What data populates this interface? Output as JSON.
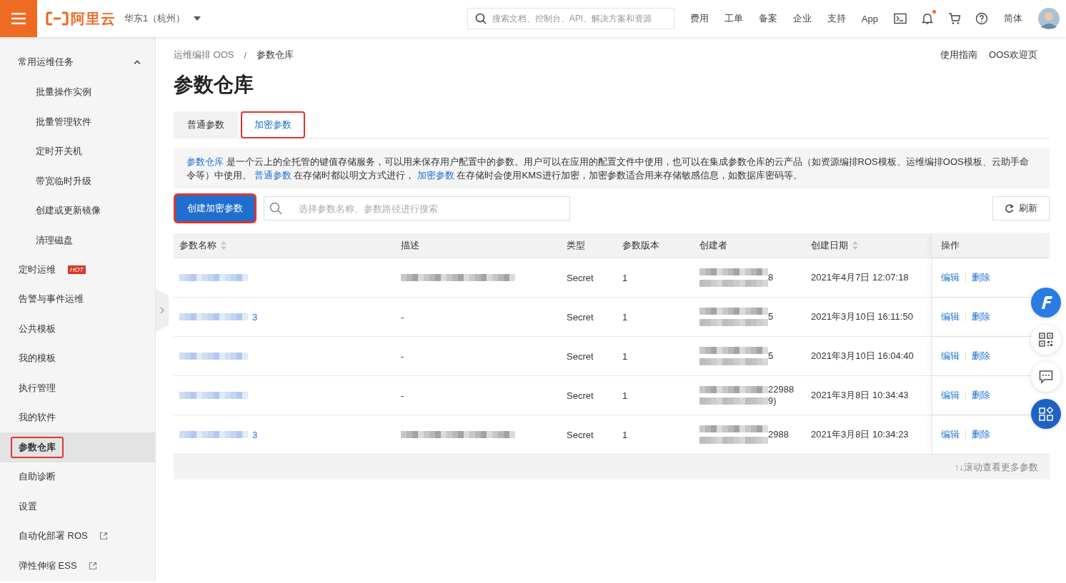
{
  "topbar": {
    "brand": "阿里云",
    "region": "华东1（杭州）",
    "search": {
      "placeholder": "搜索文档、控制台、API、解决方案和资源"
    },
    "links": [
      "费用",
      "工单",
      "备案",
      "企业",
      "支持",
      "App"
    ],
    "notification_dot": true,
    "language": "简体"
  },
  "sidebar": {
    "groups": [
      {
        "label": "常用运维任务",
        "expanded": true,
        "children": [
          {
            "label": "批量操作实例",
            "selected": false
          },
          {
            "label": "批量管理软件",
            "selected": false
          },
          {
            "label": "定时开关机",
            "selected": false
          },
          {
            "label": "带宽临时升级",
            "selected": false
          },
          {
            "label": "创建或更新镜像",
            "selected": false
          },
          {
            "label": "清理磁盘",
            "selected": false
          }
        ]
      }
    ],
    "items": [
      {
        "label": "定时运维",
        "badge": "HOT",
        "selected": false,
        "highlighted": false
      },
      {
        "label": "告警与事件运维",
        "selected": false,
        "highlighted": false
      },
      {
        "label": "公共模板",
        "selected": false,
        "highlighted": false
      },
      {
        "label": "我的模板",
        "selected": false,
        "highlighted": false
      },
      {
        "label": "执行管理",
        "selected": false,
        "highlighted": false
      },
      {
        "label": "我的软件",
        "selected": false,
        "highlighted": false
      },
      {
        "label": "参数仓库",
        "selected": true,
        "highlighted": true
      },
      {
        "label": "自助诊断",
        "selected": false,
        "highlighted": false
      },
      {
        "label": "设置",
        "selected": false,
        "highlighted": false
      },
      {
        "label": "自动化部署 ROS",
        "external": true,
        "selected": false,
        "highlighted": false
      },
      {
        "label": "弹性伸缩 ESS",
        "external": true,
        "selected": false,
        "highlighted": false
      }
    ]
  },
  "breadcrumb": {
    "items": [
      "运维编排 OOS",
      "参数仓库"
    ],
    "separator": "/"
  },
  "header_links": [
    "使用指南",
    "OOS欢迎页"
  ],
  "page_title": "参数仓库",
  "tabs": [
    {
      "label": "普通参数",
      "selected": false,
      "highlighted": false
    },
    {
      "label": "加密参数",
      "selected": true,
      "highlighted": true
    }
  ],
  "notice": [
    {
      "kind": "link",
      "text": "参数仓库"
    },
    {
      "kind": "text",
      "text": "是一个云上的全托管的键值存储服务，可以用来保存用户配置中的参数。用户可以在应用的配置文件中使用，也可以在集成参数仓库的云产品（如资源编排ROS模板、运维编排OOS模板、云助手命令等）中使用。"
    },
    {
      "kind": "link",
      "text": "普通参数"
    },
    {
      "kind": "text",
      "text": "在存储时都以明文方式进行，"
    },
    {
      "kind": "link",
      "text": "加密参数"
    },
    {
      "kind": "text",
      "text": "在存储时会使用KMS进行加密，加密参数适合用来存储敏感信息，如数据库密码等。"
    }
  ],
  "toolbar": {
    "create_button": {
      "label": "创建加密参数",
      "highlighted": true
    },
    "search": {
      "placeholder": "选择参数名称、参数路径进行搜索"
    },
    "refresh_button": "刷新"
  },
  "table": {
    "columns": [
      {
        "label": "参数名称",
        "sortable": true
      },
      {
        "label": "描述",
        "sortable": false
      },
      {
        "label": "类型",
        "sortable": false
      },
      {
        "label": "参数版本",
        "sortable": false
      },
      {
        "label": "创建者",
        "sortable": false
      },
      {
        "label": "创建日期",
        "sortable": true
      },
      {
        "label": "操作",
        "sortable": false
      }
    ],
    "rows": [
      {
        "name": {
          "redacted": true
        },
        "description": {
          "redacted": true
        },
        "type": "Secret",
        "version": "1",
        "creator": {
          "redacted": true,
          "tails": [
            "8"
          ]
        },
        "created": "2021年4月7日 12:07:18",
        "actions": [
          "编辑",
          "删除"
        ]
      },
      {
        "name": {
          "redacted": true,
          "tail": "3"
        },
        "description": {
          "text": "-"
        },
        "type": "Secret",
        "version": "1",
        "creator": {
          "redacted": true,
          "tails": [
            "5"
          ]
        },
        "created": "2021年3月10日 16:11:50",
        "actions": [
          "编辑",
          "删除"
        ]
      },
      {
        "name": {
          "redacted": true
        },
        "description": {
          "text": "-"
        },
        "type": "Secret",
        "version": "1",
        "creator": {
          "redacted": true,
          "tails": [
            "5"
          ]
        },
        "created": "2021年3月10日 16:04:40",
        "actions": [
          "编辑",
          "删除"
        ]
      },
      {
        "name": {
          "redacted": true
        },
        "description": {
          "text": "-"
        },
        "type": "Secret",
        "version": "1",
        "creator": {
          "redacted": true,
          "tails": [
            "22988",
            "9)"
          ]
        },
        "created": "2021年3月8日 10:34:43",
        "actions": [
          "编辑",
          "删除"
        ]
      },
      {
        "name": {
          "redacted": true,
          "tail": "3"
        },
        "description": {
          "redacted": true
        },
        "type": "Secret",
        "version": "1",
        "creator": {
          "redacted": true,
          "tails": [
            "2988"
          ]
        },
        "created": "2021年3月8日 10:34:23",
        "actions": [
          "编辑",
          "删除"
        ]
      }
    ],
    "footer": "↑↓滚动查看更多参数"
  }
}
